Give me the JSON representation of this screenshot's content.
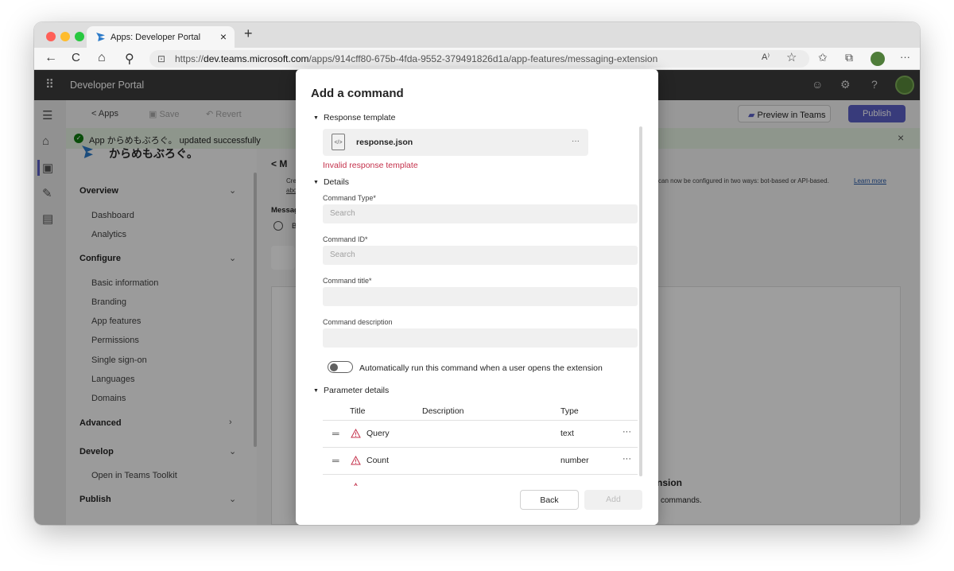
{
  "browser": {
    "tab_title": "Apps: Developer Portal",
    "tab_close": "×",
    "new_tab": "+",
    "url_prefix": "https://",
    "url_host": "dev.teams.microsoft.com",
    "url_path": "/apps/914cff80-675b-4fda-9552-379491826d1a/app-features/messaging-extension",
    "nav": {
      "back": "←",
      "reload": "C",
      "home": "⌂",
      "search": "⚲"
    },
    "right_icons": {
      "read_aloud": "A⁾",
      "favorite": "☆",
      "favorites_bar": "✩",
      "collections": "⧉",
      "more": "···"
    }
  },
  "portal": {
    "app_name": "Developer Portal",
    "cmd": {
      "back": "< Apps",
      "save": "Save",
      "revert": "Revert",
      "preview": "Preview in Teams",
      "publish": "Publish"
    },
    "banner": "App からめもぶろぐ。 updated successfully",
    "banner_close": "×",
    "app_title": "からめもぶろぐ。",
    "nav": {
      "overview": "Overview",
      "dashboard": "Dashboard",
      "analytics": "Analytics",
      "configure": "Configure",
      "basic_information": "Basic information",
      "branding": "Branding",
      "app_features": "App features",
      "permissions": "Permissions",
      "sso": "Single sign-on",
      "languages": "Languages",
      "domains": "Domains",
      "advanced": "Advanced",
      "develop": "Develop",
      "open_toolkit": "Open in Teams Toolkit",
      "publish": "Publish"
    },
    "main": {
      "back_title": "< M",
      "desc_a": "Cre",
      "desc_b": "abo",
      "desc_right": "can now be configured in two ways: bot-based or API-based.",
      "learn_more": "Learn more",
      "messag": "Messag",
      "radio_label": "B",
      "empty_title": "nsion",
      "empty_desc": "commands."
    }
  },
  "modal": {
    "title": "Add a command",
    "response_section": "Response template",
    "file_name": "response.json",
    "file_more": "···",
    "file_error": "Invalid response template",
    "details_section": "Details",
    "command_type_label": "Command Type*",
    "command_type_placeholder": "Search",
    "command_id_label": "Command ID*",
    "command_id_placeholder": "Search",
    "command_title_label": "Command title*",
    "command_description_label": "Command description",
    "auto_run_label": "Automatically run this command when a user opens the extension",
    "auto_run_on": false,
    "param_section": "Parameter details",
    "param_headers": {
      "title": "Title",
      "description": "Description",
      "type": "Type"
    },
    "params": [
      {
        "title": "Query",
        "description": "",
        "type": "text"
      },
      {
        "title": "Count",
        "description": "",
        "type": "number"
      }
    ],
    "back_button": "Back",
    "add_button": "Add"
  },
  "colors": {
    "error": "#c4314b",
    "publish": "#5b5fc7",
    "success": "#107c10"
  }
}
